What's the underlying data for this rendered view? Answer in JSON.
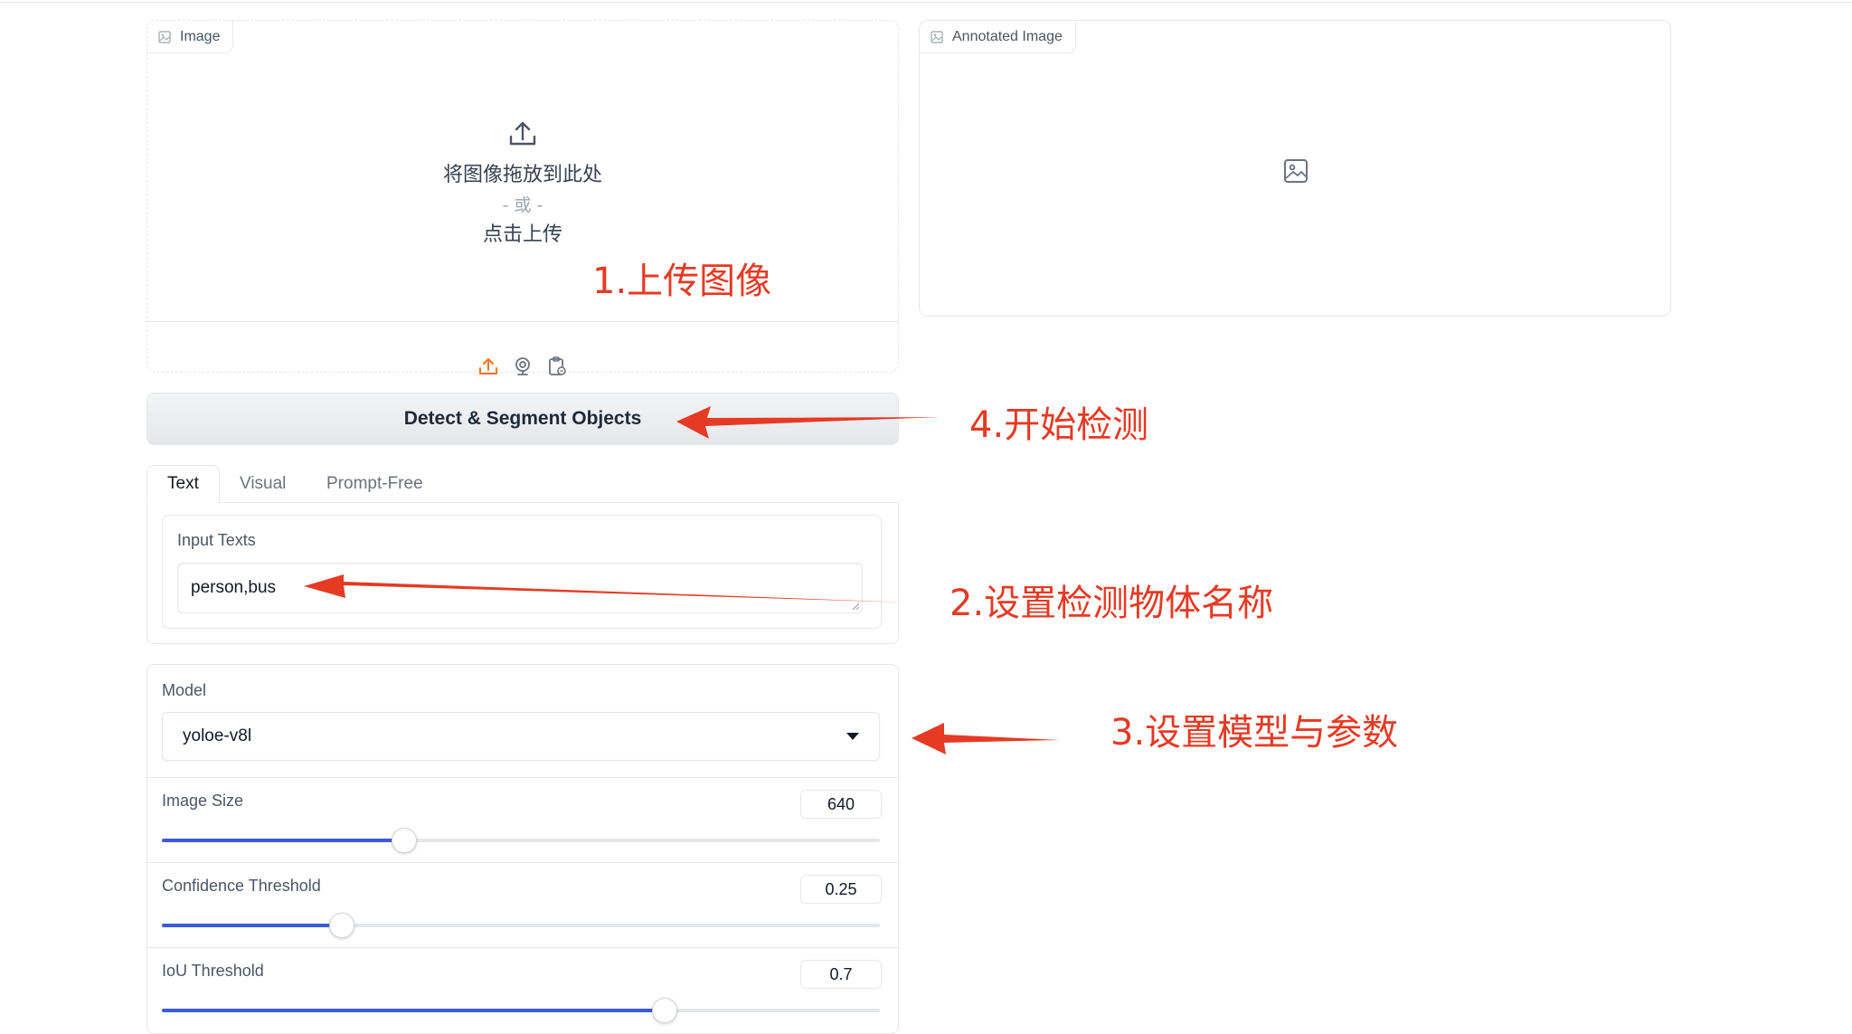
{
  "image_panel": {
    "label": "Image",
    "drop_text": "将图像拖放到此处",
    "or_text": "- 或 -",
    "click_text": "点击上传"
  },
  "annotated_panel": {
    "label": "Annotated Image"
  },
  "detect_button": {
    "label": "Detect & Segment Objects"
  },
  "tabs": [
    {
      "label": "Text",
      "active": true
    },
    {
      "label": "Visual",
      "active": false
    },
    {
      "label": "Prompt-Free",
      "active": false
    }
  ],
  "input_texts": {
    "label": "Input Texts",
    "value": "person,bus"
  },
  "model": {
    "label": "Model",
    "value": "yoloe-v8l"
  },
  "sliders": [
    {
      "label": "Image Size",
      "value": "640",
      "fraction": 0.338
    },
    {
      "label": "Confidence Threshold",
      "value": "0.25",
      "fraction": 0.25
    },
    {
      "label": "IoU Threshold",
      "value": "0.7",
      "fraction": 0.7
    }
  ],
  "annotations": {
    "step1": "1.上传图像",
    "step2": "2.设置检测物体名称",
    "step3": "3.设置模型与参数",
    "step4": "4.开始检测"
  },
  "colors": {
    "annotation_red": "#e53a24",
    "slider_blue": "#3b5bdb",
    "upload_orange": "#f97316"
  },
  "icons": [
    "image-icon",
    "upload-icon",
    "webcam-icon",
    "clipboard-icon",
    "image-placeholder-icon",
    "chevron-down-icon"
  ]
}
